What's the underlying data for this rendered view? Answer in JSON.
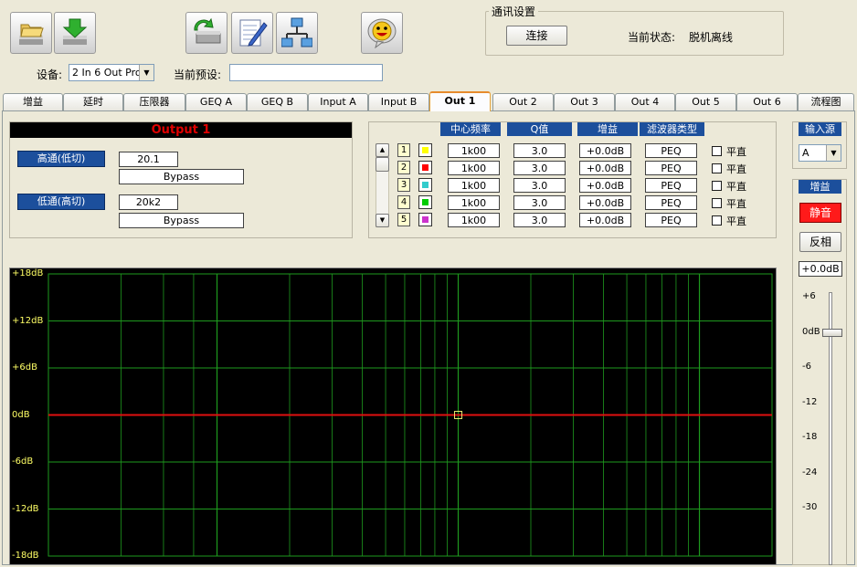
{
  "toolbar": {
    "buttons": [
      {
        "name": "open-file",
        "icon": "folder-open-icon"
      },
      {
        "name": "save-file",
        "icon": "download-arrow-icon"
      },
      {
        "name": "load-device",
        "icon": "device-refresh-icon"
      },
      {
        "name": "edit",
        "icon": "notepad-pencil-icon"
      },
      {
        "name": "network",
        "icon": "network-icon"
      },
      {
        "name": "about",
        "icon": "smiley-bubble-icon"
      }
    ],
    "device_label": "设备:",
    "device_value": "2 In 6 Out Pro",
    "preset_label": "当前预设:",
    "preset_value": ""
  },
  "comm": {
    "title": "通讯设置",
    "connect_label": "连接",
    "status_label": "当前状态:",
    "status_value": "脱机离线"
  },
  "tabs": [
    "增益",
    "延时",
    "压限器",
    "GEQ A",
    "GEQ B",
    "Input A",
    "Input B",
    "Out 1",
    "Out 2",
    "Out 3",
    "Out 4",
    "Out 5",
    "Out 6",
    "流程图"
  ],
  "active_tab": "Out 1",
  "output": {
    "title": "Output 1",
    "highpass_label": "高通(低切)",
    "highpass_freq": "20.1",
    "highpass_type": "Bypass",
    "lowpass_label": "低通(高切)",
    "lowpass_freq": "20k2",
    "lowpass_type": "Bypass"
  },
  "peq": {
    "headers": [
      "中心频率",
      "Q值",
      "增益",
      "滤波器类型"
    ],
    "bands": [
      {
        "num": "1",
        "color": "#ffff00",
        "freq": "1k00",
        "q": "3.0",
        "gain": "+0.0dB",
        "type": "PEQ",
        "flat": "平直"
      },
      {
        "num": "2",
        "color": "#ff0000",
        "freq": "1k00",
        "q": "3.0",
        "gain": "+0.0dB",
        "type": "PEQ",
        "flat": "平直"
      },
      {
        "num": "3",
        "color": "#33cccc",
        "freq": "1k00",
        "q": "3.0",
        "gain": "+0.0dB",
        "type": "PEQ",
        "flat": "平直"
      },
      {
        "num": "4",
        "color": "#00cc00",
        "freq": "1k00",
        "q": "3.0",
        "gain": "+0.0dB",
        "type": "PEQ",
        "flat": "平直"
      },
      {
        "num": "5",
        "color": "#cc33cc",
        "freq": "1k00",
        "q": "3.0",
        "gain": "+0.0dB",
        "type": "PEQ",
        "flat": "平直"
      }
    ]
  },
  "right": {
    "input_source_label": "输入源",
    "input_source_value": "A",
    "gain_label": "增益",
    "mute_label": "静音",
    "invert_label": "反相",
    "gain_value": "+0.0dB",
    "scale": [
      "+6",
      "0dB",
      "-6",
      "-12",
      "-18",
      "-24",
      "-30"
    ]
  },
  "graph": {
    "y_labels": [
      "+18dB",
      "+12dB",
      "+6dB",
      "0dB",
      "-6dB",
      "-12dB",
      "-18dB"
    ],
    "colors": {
      "background": "#000000",
      "grid": "#1e9a1e",
      "curve": "#e01010",
      "marker": "#e8e870"
    }
  },
  "chart_data": {
    "type": "line",
    "x_scale": "log",
    "xlim": [
      20,
      20000
    ],
    "ylim": [
      -18,
      18
    ],
    "y_ticks": [
      "+18dB",
      "+12dB",
      "+6dB",
      "0dB",
      "-6dB",
      "-12dB",
      "-18dB"
    ],
    "series": [
      {
        "x": [
          20,
          20000
        ],
        "values": [
          0,
          0
        ]
      }
    ],
    "markers": [
      {
        "x": 1000,
        "y": 0
      }
    ]
  }
}
